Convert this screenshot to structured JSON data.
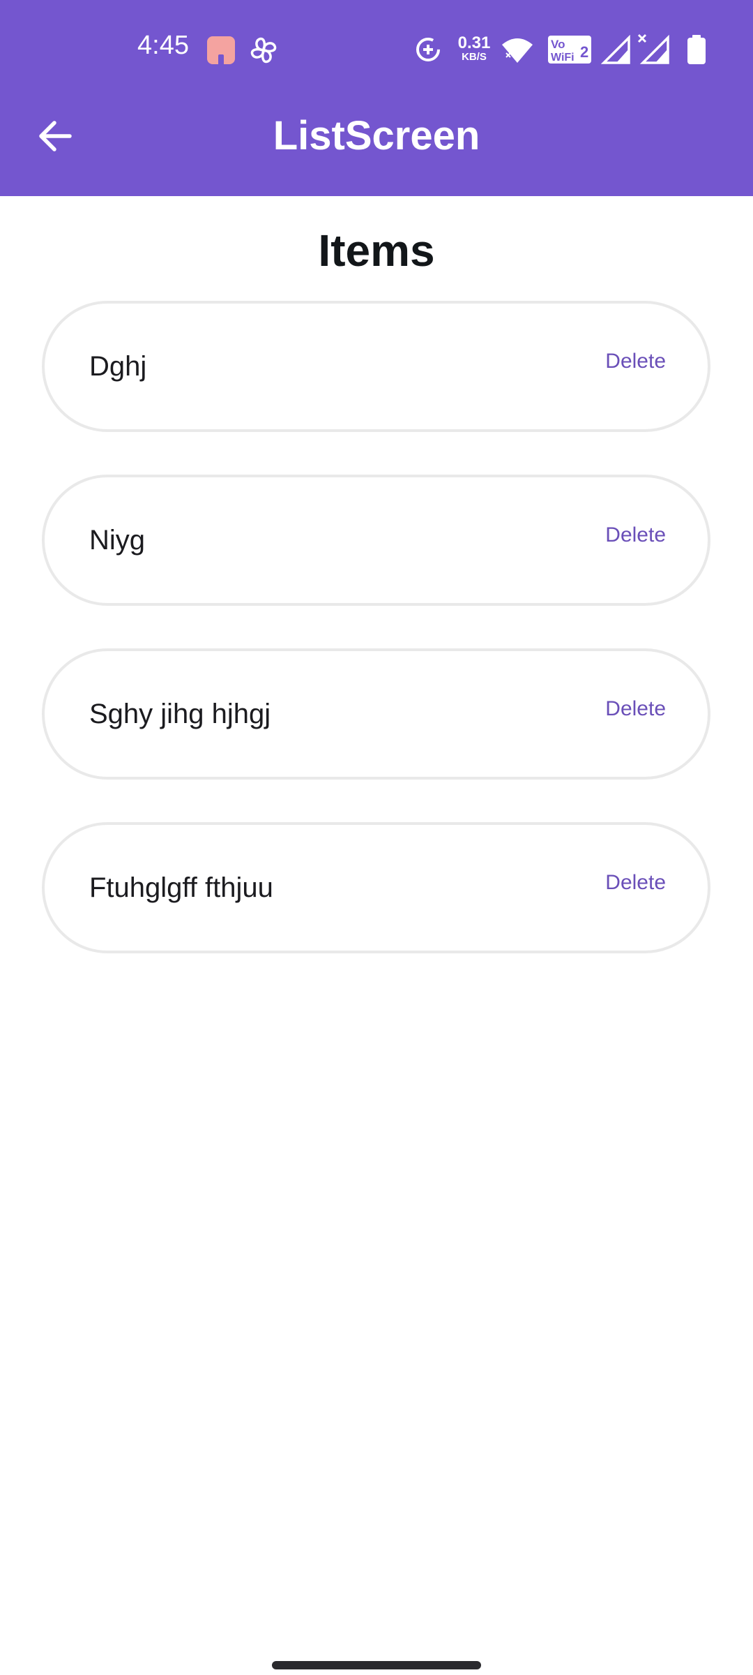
{
  "status_bar": {
    "time": "4:45",
    "net_speed_value": "0.31",
    "net_speed_unit": "KB/S",
    "vowifi_label": "Vo WiFi 2"
  },
  "app_bar": {
    "title": "ListScreen",
    "back_icon": "arrow-back-icon"
  },
  "section": {
    "title": "Items"
  },
  "items": [
    {
      "label": "Dghj",
      "action": "Delete"
    },
    {
      "label": "Niyg",
      "action": "Delete"
    },
    {
      "label": "Sghy jihg hjhgj",
      "action": "Delete"
    },
    {
      "label": "Ftuhglgff fthjuu",
      "action": "Delete"
    }
  ],
  "colors": {
    "primary": "#7456CF",
    "accent_text": "#6A4FB8",
    "card_border": "#E9E9E9"
  }
}
